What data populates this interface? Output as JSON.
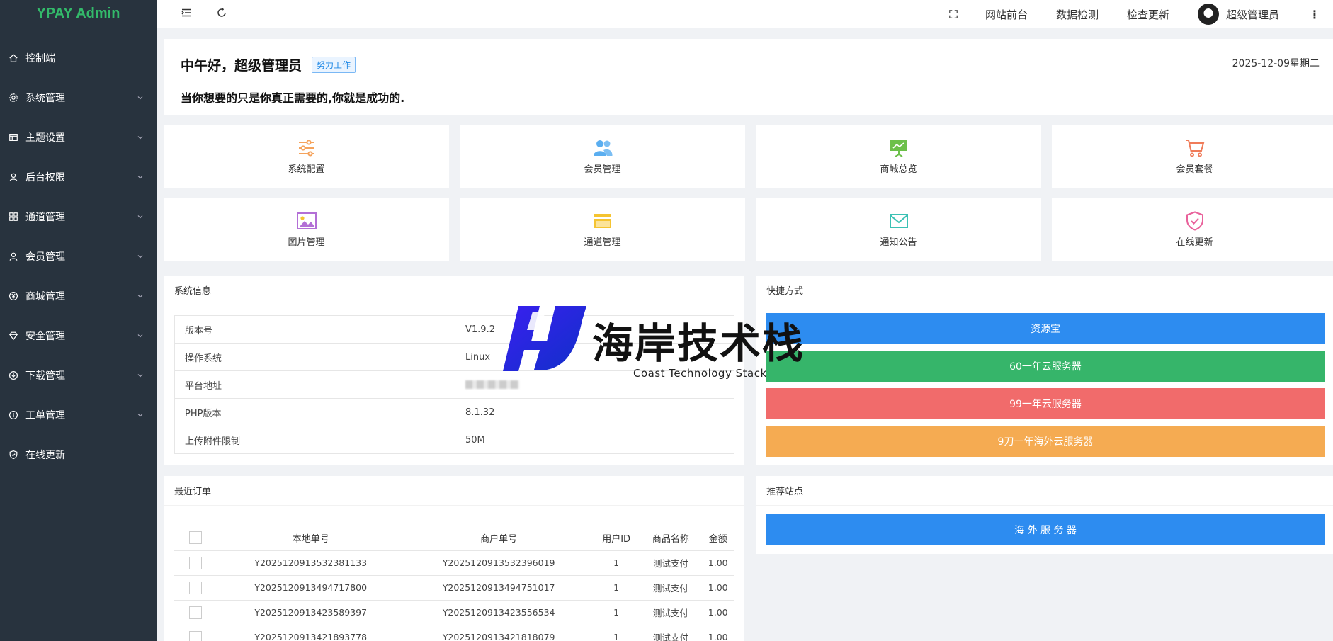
{
  "app": {
    "title": "YPAY Admin"
  },
  "sidebar": {
    "items": [
      {
        "label": "控制端",
        "icon": "home-icon",
        "expandable": false
      },
      {
        "label": "系统管理",
        "icon": "gear-icon",
        "expandable": true
      },
      {
        "label": "主题设置",
        "icon": "layout-icon",
        "expandable": true
      },
      {
        "label": "后台权限",
        "icon": "user-icon",
        "expandable": true
      },
      {
        "label": "通道管理",
        "icon": "apps-icon",
        "expandable": true
      },
      {
        "label": "会员管理",
        "icon": "user-icon",
        "expandable": true
      },
      {
        "label": "商城管理",
        "icon": "yen-icon",
        "expandable": true
      },
      {
        "label": "安全管理",
        "icon": "diamond-icon",
        "expandable": true
      },
      {
        "label": "下载管理",
        "icon": "download-icon",
        "expandable": true
      },
      {
        "label": "工单管理",
        "icon": "info-icon",
        "expandable": true
      },
      {
        "label": "在线更新",
        "icon": "shield-check-icon",
        "expandable": false
      }
    ]
  },
  "header": {
    "links": [
      "网站前台",
      "数据检测",
      "检查更新"
    ],
    "user_name": "超级管理员"
  },
  "greeting": {
    "title": "中午好，超级管理员",
    "badge": "努力工作",
    "date": "2025-12-09星期二",
    "motto": "当你想要的只是你真正需要的,你就是成功的."
  },
  "tiles": [
    {
      "label": "系统配置",
      "icon": "sliders-icon",
      "color": "#f5a35c"
    },
    {
      "label": "会员管理",
      "icon": "users-icon",
      "color": "#5aaef0"
    },
    {
      "label": "商城总览",
      "icon": "presentation-icon",
      "color": "#6cc04a"
    },
    {
      "label": "会员套餐",
      "icon": "cart-icon",
      "color": "#f07c5a"
    },
    {
      "label": "图片管理",
      "icon": "image-icon",
      "color": "#b36fd6"
    },
    {
      "label": "通道管理",
      "icon": "card-icon",
      "color": "#f5c431"
    },
    {
      "label": "通知公告",
      "icon": "mail-icon",
      "color": "#3bc1b4"
    },
    {
      "label": "在线更新",
      "icon": "shield-check-icon",
      "color": "#e9619b"
    }
  ],
  "system_info": {
    "title": "系统信息",
    "rows": [
      {
        "key": "版本号",
        "value": "V1.9.2"
      },
      {
        "key": "操作系统",
        "value": "Linux"
      },
      {
        "key": "平台地址",
        "value": ""
      },
      {
        "key": "PHP版本",
        "value": "8.1.32"
      },
      {
        "key": "上传附件限制",
        "value": "50M"
      }
    ]
  },
  "shortcuts": {
    "title": "快捷方式",
    "buttons": [
      {
        "label": "资源宝",
        "color": "#2d8cf0"
      },
      {
        "label": "60一年云服务器",
        "color": "#36b56a"
      },
      {
        "label": "99一年云服务器",
        "color": "#f16b6b"
      },
      {
        "label": "9刀一年海外云服务器",
        "color": "#f5ab52"
      }
    ]
  },
  "recommended": {
    "title": "推荐站点",
    "button": {
      "label": "海 外 服 务 器",
      "color": "#2d8cf0"
    }
  },
  "orders": {
    "title": "最近订单",
    "columns": [
      "本地单号",
      "商户单号",
      "用户ID",
      "商品名称",
      "金额"
    ],
    "rows": [
      [
        "Y2025120913532381133",
        "Y2025120913532396019",
        "1",
        "测试支付",
        "1.00"
      ],
      [
        "Y2025120913494717800",
        "Y2025120913494751017",
        "1",
        "测试支付",
        "1.00"
      ],
      [
        "Y2025120913423589397",
        "Y2025120913423556534",
        "1",
        "测试支付",
        "1.00"
      ],
      [
        "Y2025120913421893778",
        "Y2025120913421818079",
        "1",
        "测试支付",
        "1.00"
      ]
    ]
  },
  "watermark": {
    "text": "海岸技术栈",
    "subtext": "Coast Technology Stack"
  }
}
